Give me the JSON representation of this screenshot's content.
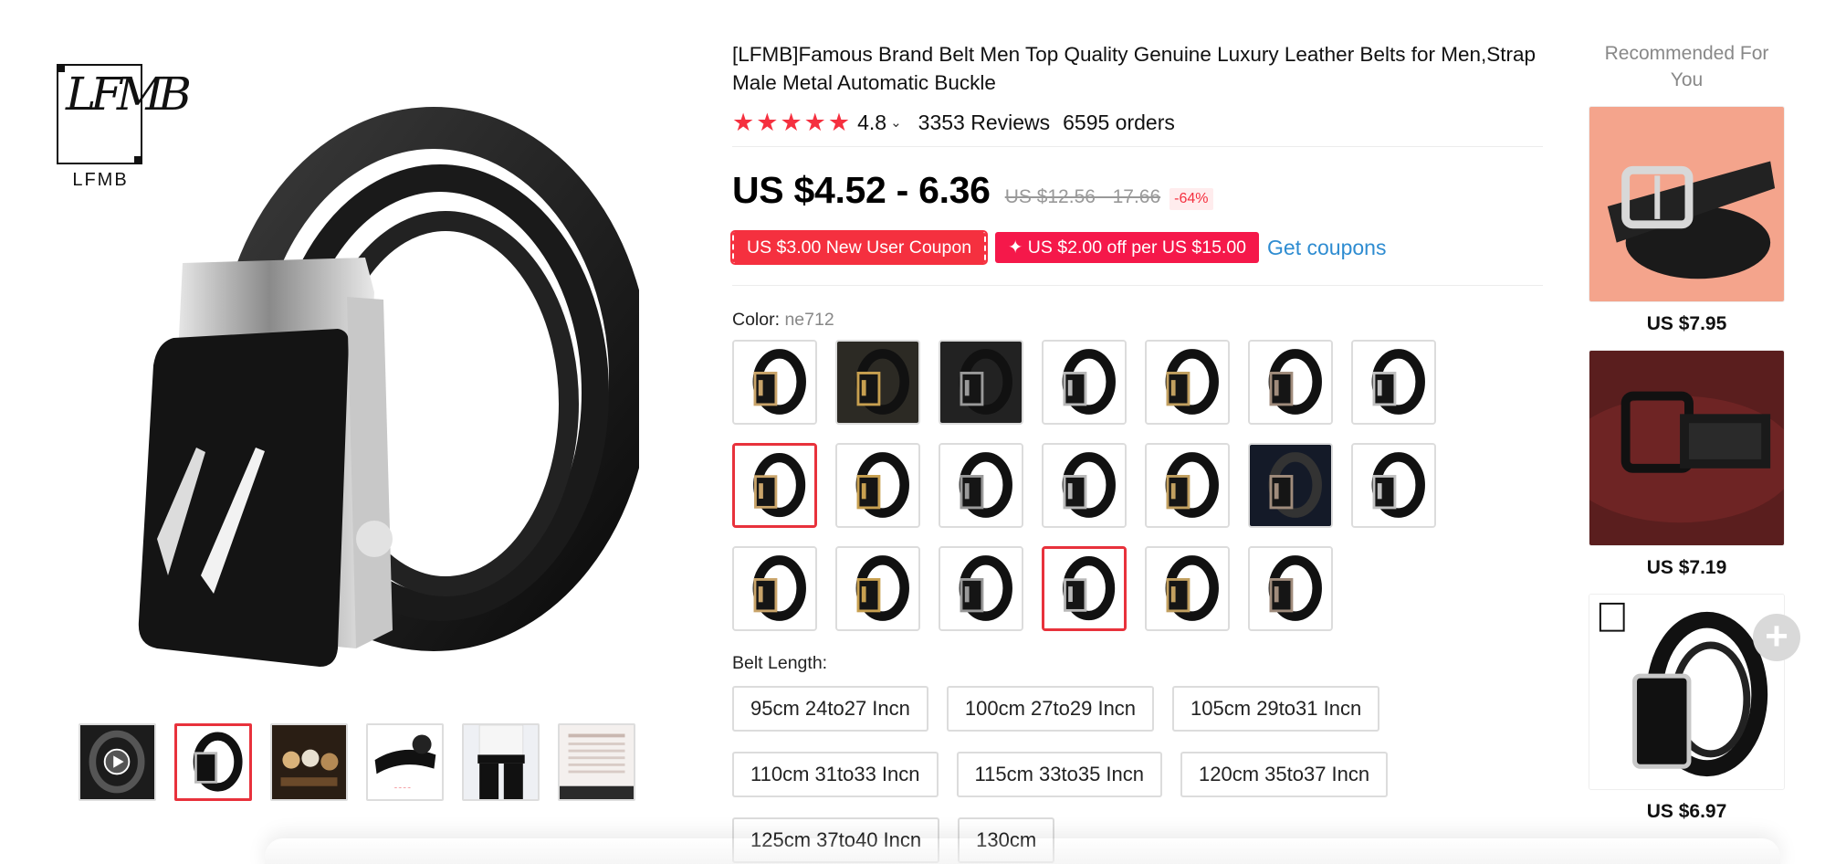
{
  "brand_logo": {
    "mark": "LFMB",
    "word": "LFMB"
  },
  "product": {
    "title": "[LFMB]Famous Brand Belt Men Top Quality Genuine Luxury Leather Belts for Men,Strap Male Metal Automatic Buckle",
    "rating": "4.8",
    "stars": 5,
    "reviews": "3353 Reviews",
    "orders": "6595 orders",
    "price": "US $4.52 - 6.36",
    "original_price": "US $12.56 - 17.66",
    "discount": "-64%",
    "coupons": [
      {
        "label": "US $3.00 New User Coupon"
      },
      {
        "label": "✦ US $2.00 off per US $15.00"
      }
    ],
    "get_coupons": "Get coupons",
    "color_label": "Color:",
    "color_value": "ne712",
    "swatch_count": 20,
    "selected_swatches": [
      7,
      17
    ],
    "length_label": "Belt Length:",
    "lengths": [
      "95cm 24to27 Incn",
      "100cm 27to29 Incn",
      "105cm 29to31 Incn",
      "110cm 31to33 Incn",
      "115cm 33to35 Incn",
      "120cm 35to37 Incn",
      "125cm 37to40 Incn",
      "130cm"
    ]
  },
  "gallery": {
    "thumb_count": 6,
    "selected_thumb": 1,
    "video_thumb": 0
  },
  "recommended": {
    "title": "Recommended For You",
    "items": [
      {
        "price": "US $7.95"
      },
      {
        "price": "US $7.19"
      },
      {
        "price": "US $6.97"
      }
    ]
  },
  "icons": {
    "star": "star-icon",
    "chevron": "chevron-down-icon",
    "play": "play-icon",
    "add": "plus-icon"
  },
  "colors": {
    "accent_red": "#f5303f",
    "link_blue": "#2e8cd1"
  }
}
